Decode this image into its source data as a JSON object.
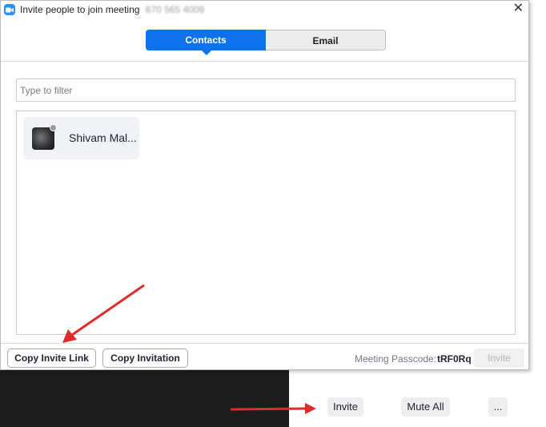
{
  "dialog": {
    "title": "Invite people to join meeting",
    "meeting_id": "670 565 4009",
    "tabs": [
      {
        "label": "Contacts",
        "selected": true
      },
      {
        "label": "Email",
        "selected": false
      }
    ],
    "filter_placeholder": "Type to filter",
    "contacts": [
      {
        "name": "Shivam Mal...",
        "status": "offline"
      }
    ],
    "copy_invite_link_label": "Copy Invite Link",
    "copy_invitation_label": "Copy Invitation",
    "passcode_label": "Meeting Passcode:",
    "passcode_value": "tRF0Rq",
    "invite_label": "Invite"
  },
  "toolbar": {
    "invite_label": "Invite",
    "mute_all_label": "Mute All",
    "more_label": "..."
  },
  "colors": {
    "accent": "#0e72ed",
    "annotation_arrow": "#e02b2b"
  }
}
